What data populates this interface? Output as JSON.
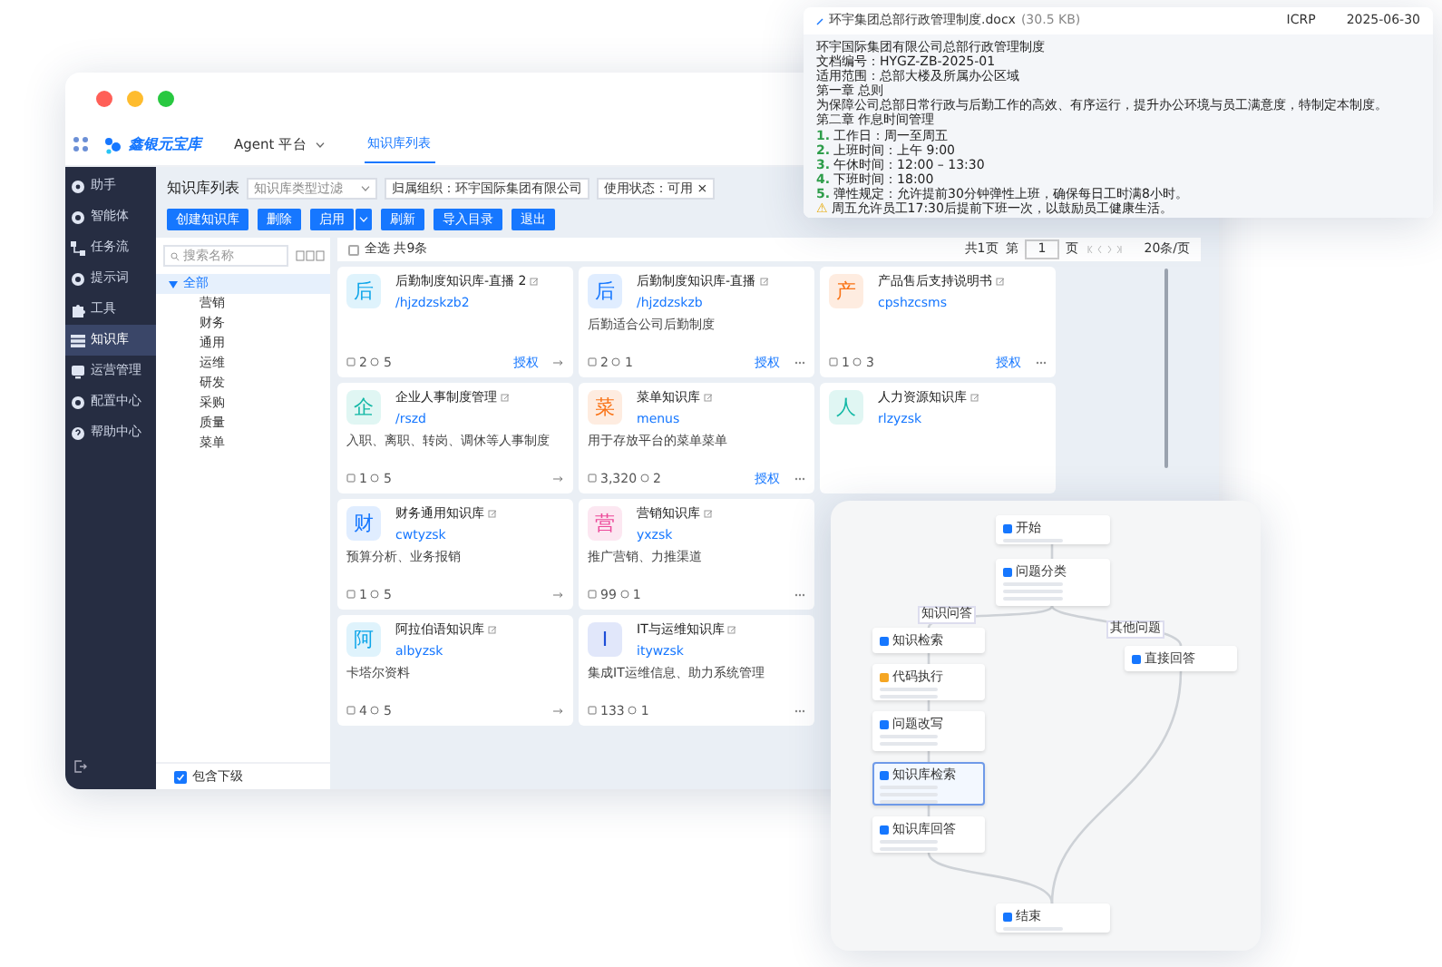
{
  "main_window": {
    "header": {
      "logo_text": "鑫银元宝库",
      "platform": "Agent 平台",
      "tabs": [
        {
          "label": "知识库列表",
          "selected": true
        }
      ]
    },
    "sidebar": {
      "items": [
        {
          "label": "助手",
          "selected": false
        },
        {
          "label": "智能体",
          "selected": false
        },
        {
          "label": "任务流",
          "selected": false
        },
        {
          "label": "提示词",
          "selected": false
        },
        {
          "label": "工具",
          "selected": false
        },
        {
          "label": "知识库",
          "selected": true
        },
        {
          "label": "运营管理",
          "selected": false
        },
        {
          "label": "配置中心",
          "selected": false
        },
        {
          "label": "帮助中心",
          "selected": false
        }
      ]
    },
    "filter_bar": {
      "title": "知识库列表",
      "type_select": {
        "placeholder": "知识库类型过滤"
      },
      "chips": [
        {
          "label": "归属组织：环宇国际集团有限公司"
        },
        {
          "label": "使用状态：可用",
          "remove": "×"
        }
      ]
    },
    "toolbar": {
      "buttons": [
        {
          "label": "创建知识库",
          "kind": "plain"
        },
        {
          "label": "删除",
          "kind": "plain"
        },
        {
          "label": "启用",
          "kind": "split"
        },
        {
          "label": "刷新",
          "kind": "plain"
        },
        {
          "label": "导入目录",
          "kind": "plain"
        },
        {
          "label": "退出",
          "kind": "plain"
        }
      ]
    },
    "tree": {
      "search": {
        "placeholder": "搜索名称"
      },
      "root": {
        "label": "全部",
        "expanded": true,
        "selected": true,
        "children": [
          {
            "label": "营销"
          },
          {
            "label": "财务"
          },
          {
            "label": "通用"
          },
          {
            "label": "运维"
          },
          {
            "label": "研发"
          },
          {
            "label": "采购"
          },
          {
            "label": "质量"
          },
          {
            "label": "菜单"
          }
        ]
      },
      "include_sub": {
        "label": "包含下级",
        "checked": true
      }
    },
    "grid": {
      "select_all": {
        "label": "全选 共9条",
        "checked": false
      },
      "pagination": {
        "total": "共1页",
        "page_prefix": "第",
        "page": "1",
        "page_suffix": "页",
        "page_size": "20条/页"
      },
      "cards": [
        {
          "avatar": "后",
          "color": "#0ea5e9",
          "title": "后勤制度知识库-直播 2",
          "code": "/hjzdzskzb2",
          "docs": "2",
          "users": "5",
          "auth": "授权",
          "kind": "link"
        },
        {
          "avatar": "企",
          "color": "#14b8a6",
          "title": "企业人事制度管理",
          "code": "/rszd",
          "description": "入职、离职、转岗、调休等人事制度",
          "docs": "1",
          "users": "5",
          "kind": "link"
        },
        {
          "avatar": "财",
          "color": "#1677ff",
          "title": "财务通用知识库",
          "code": "cwtyzsk",
          "description": "预算分析、业务报销",
          "docs": "1",
          "users": "5",
          "kind": "link"
        },
        {
          "avatar": "阿",
          "color": "#0ea5e9",
          "title": "阿拉伯语知识库",
          "code": "albyzsk",
          "description": "卡塔尔资料",
          "docs": "4",
          "users": "5",
          "kind": "link"
        },
        {
          "avatar": "后",
          "color": "#1677ff",
          "title": "后勤制度知识库-直播",
          "code": "/hjzdzskzb",
          "description": "后勤适合公司后勤制度",
          "docs": "2",
          "users": "1",
          "auth": "授权",
          "kind": "menu"
        },
        {
          "avatar": "菜",
          "color": "#f97316",
          "title": "菜单知识库",
          "code": "menus",
          "description": "用于存放平台的菜单菜单",
          "docs": "3,320",
          "users": "2",
          "auth": "授权",
          "kind": "menu"
        },
        {
          "avatar": "营",
          "color": "#ec4899",
          "title": "营销知识库",
          "code": "yxzsk",
          "description": "推广营销、力推渠道",
          "docs": "99",
          "users": "1",
          "kind": "menu"
        },
        {
          "avatar": "I",
          "color": "#1d4ed8",
          "title": "IT与运维知识库",
          "code": "itywzsk",
          "description": "集成IT运维信息、助力系统管理",
          "docs": "133",
          "users": "1",
          "kind": "menu"
        },
        {
          "avatar": "产",
          "color": "#f97316",
          "title": "产品售后支持说明书",
          "code": "cpshzcsms",
          "docs": "1",
          "users": "3",
          "auth": "授权",
          "kind": "menu"
        },
        {
          "avatar": "人",
          "color": "#14b8a6",
          "title": "人力资源知识库",
          "code": "rlzyzsk",
          "kind": "plain"
        }
      ]
    }
  },
  "document_window": {
    "file_name": "环宇集团总部行政管理制度.docx",
    "size": "(30.5 KB)",
    "author": "ICRP",
    "date": "2025-06-30",
    "lines": [
      {
        "kind": "text",
        "text": "环宇国际集团有限公司总部行政管理制度"
      },
      {
        "kind": "text",
        "text": "文档编号：HYGZ-ZB-2025-01"
      },
      {
        "kind": "text",
        "text": "适用范围：总部大楼及所属办公区域"
      },
      {
        "kind": "text",
        "text": "第一章 总则"
      },
      {
        "kind": "text",
        "text": "为保障公司总部日常行政与后勤工作的高效、有序运行，提升办公环境与员工满意度，特制定本制度。"
      },
      {
        "kind": "text",
        "text": "第二章 作息时间管理"
      },
      {
        "kind": "numbered",
        "marker": "1.",
        "text": "工作日：周一至周五"
      },
      {
        "kind": "numbered",
        "marker": "2.",
        "text": "上班时间：上午 9:00"
      },
      {
        "kind": "numbered",
        "marker": "3.",
        "text": "午休时间：12:00 – 13:30"
      },
      {
        "kind": "numbered",
        "marker": "4.",
        "text": "下班时间：18:00"
      },
      {
        "kind": "numbered",
        "marker": "5.",
        "text": "弹性规定：允许提前30分钟弹性上班，确保每日工时满8小时。"
      },
      {
        "kind": "warning",
        "marker": "⚠",
        "text": "周五允许员工17:30后提前下班一次，以鼓励员工健康生活。"
      }
    ]
  },
  "flow_window": {
    "nodes": [
      {
        "title": "开始",
        "kind": "start",
        "selected": false
      },
      {
        "title": "问题分类",
        "kind": "classify",
        "selected": false
      },
      {
        "title": "知识检索",
        "kind": "search",
        "selected": false
      },
      {
        "title": "代码执行",
        "kind": "code",
        "selected": false
      },
      {
        "title": "问题改写",
        "kind": "llm",
        "selected": false
      },
      {
        "title": "知识库检索",
        "kind": "search",
        "selected": true
      },
      {
        "title": "知识库回答",
        "kind": "llm",
        "selected": false
      },
      {
        "title": "直接回答",
        "kind": "llm",
        "selected": false
      },
      {
        "title": "结束",
        "kind": "end",
        "selected": false
      }
    ],
    "edge_labels": [
      "知识问答",
      "其他问题"
    ]
  }
}
